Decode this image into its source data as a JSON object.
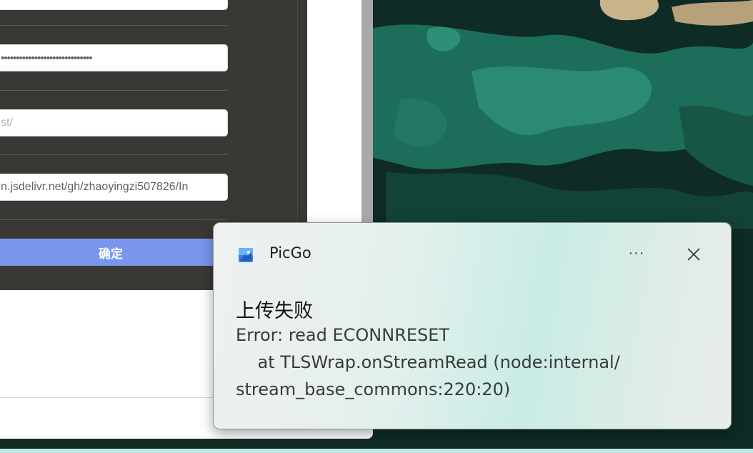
{
  "settings_form": {
    "password_value": "••••••••••••••••••••••••••••••",
    "path_placeholder": "st/",
    "custom_url_value": "n.jsdelivr.net/gh/zhaoyingzi507826/In",
    "confirm_label": "确定"
  },
  "toast": {
    "app_icon": "picgo-app-icon",
    "app_name": "PicGo",
    "more_label": "···",
    "close_icon": "close-icon",
    "title": "上传失败",
    "message_lines": [
      "Error: read ECONNRESET",
      "    at TLSWrap.onStreamRead (node:internal/",
      "stream_base_commons:220:20)"
    ]
  },
  "colors": {
    "accent_button": "#7a96ec",
    "panel_background": "#3a3835",
    "wallpaper_teal": "#1f6b57"
  }
}
